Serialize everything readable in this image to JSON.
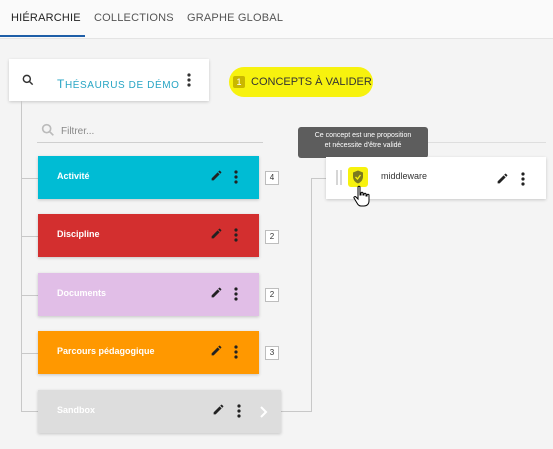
{
  "tabs": [
    {
      "label": "HIÉRARCHIE",
      "active": true
    },
    {
      "label": "COLLECTIONS",
      "active": false
    },
    {
      "label": "GRAPHE GLOBAL",
      "active": false
    }
  ],
  "thesaurus": {
    "title_first": "T",
    "title_rest": "HÉSAURUS DE DÉMO",
    "title_first2": "D",
    "title_rest2": "ÉMO"
  },
  "validate": {
    "count": "1",
    "label": "CONCEPTS À VALIDER",
    "highlight_color": "#f7f20e"
  },
  "filter": {
    "placeholder": "Filtrer..."
  },
  "collections": [
    {
      "name": "Activité",
      "color": "#00bcd4",
      "count": "4"
    },
    {
      "name": "Discipline",
      "color": "#d32f2f",
      "count": "2"
    },
    {
      "name": "Documents",
      "color": "#e1bee7",
      "count": "2"
    },
    {
      "name": "Parcours pédagogique",
      "color": "#ff9800",
      "count": "3"
    },
    {
      "name": "Sandbox",
      "color": "#dddddd",
      "count": ""
    }
  ],
  "tooltip": {
    "line1": "Ce concept est une proposition",
    "line2": "et nécessite d'être validé"
  },
  "concept": {
    "name": "middleware"
  }
}
